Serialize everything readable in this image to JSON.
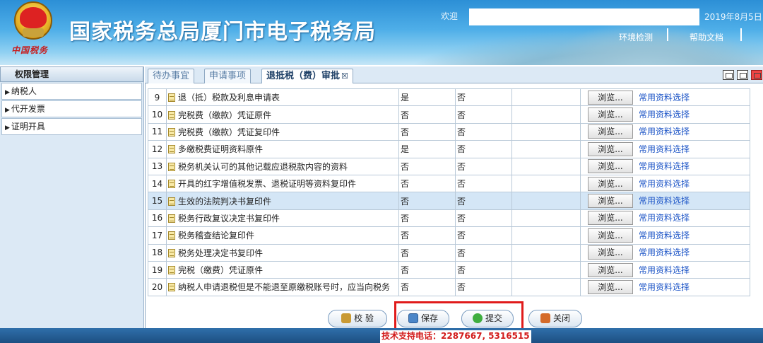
{
  "header": {
    "title": "国家税务总局厦门市电子税务局",
    "brand_small": "中国税务",
    "welcome": "欢迎",
    "date": "2019年8月5日",
    "links": [
      "环境检测",
      "帮助文档"
    ]
  },
  "sidebar": {
    "title": "权限管理",
    "items": [
      {
        "label": "纳税人"
      },
      {
        "label": "代开发票"
      },
      {
        "label": "证明开具"
      }
    ]
  },
  "tabs": [
    {
      "label": "待办事宜",
      "active": false
    },
    {
      "label": "申请事项",
      "active": false
    },
    {
      "label": "退抵税（费）审批",
      "active": true,
      "close": "☒"
    }
  ],
  "table": {
    "browse_label": "浏览...",
    "common_label": "常用资料选择",
    "rows": [
      {
        "no": "9",
        "name": "退（抵）税款及利息申请表",
        "required": "是",
        "submitted": "否"
      },
      {
        "no": "10",
        "name": "完税费（缴款）凭证原件",
        "required": "否",
        "submitted": "否"
      },
      {
        "no": "11",
        "name": "完税费（缴款）凭证复印件",
        "required": "否",
        "submitted": "否"
      },
      {
        "no": "12",
        "name": "多缴税费证明资料原件",
        "required": "是",
        "submitted": "否"
      },
      {
        "no": "13",
        "name": "税务机关认可的其他记载应退税款内容的资料",
        "required": "否",
        "submitted": "否"
      },
      {
        "no": "14",
        "name": "开具的红字增值税发票、退税证明等资料复印件",
        "required": "否",
        "submitted": "否"
      },
      {
        "no": "15",
        "name": "生效的法院判决书复印件",
        "required": "否",
        "submitted": "否"
      },
      {
        "no": "16",
        "name": "税务行政复议决定书复印件",
        "required": "否",
        "submitted": "否"
      },
      {
        "no": "17",
        "name": "税务稽查结论复印件",
        "required": "否",
        "submitted": "否"
      },
      {
        "no": "18",
        "name": "税务处理决定书复印件",
        "required": "否",
        "submitted": "否"
      },
      {
        "no": "19",
        "name": "完税（缴费）凭证原件",
        "required": "否",
        "submitted": "否"
      },
      {
        "no": "20",
        "name": "纳税人申请退税但是不能退至原缴税账号时，应当向税务",
        "required": "否",
        "submitted": "否"
      }
    ],
    "highlight_row": "15"
  },
  "buttons": {
    "check": "校 验",
    "save": "保存",
    "submit": "提交",
    "close": "关闭"
  },
  "footer": {
    "support": "技术支持电话：2287667, 5316515"
  },
  "colors": {
    "header_blue": "#2c8fd6",
    "highlight_row": "#d4e6f6",
    "link": "#1d55c7",
    "alert_red": "#e01b1b"
  }
}
